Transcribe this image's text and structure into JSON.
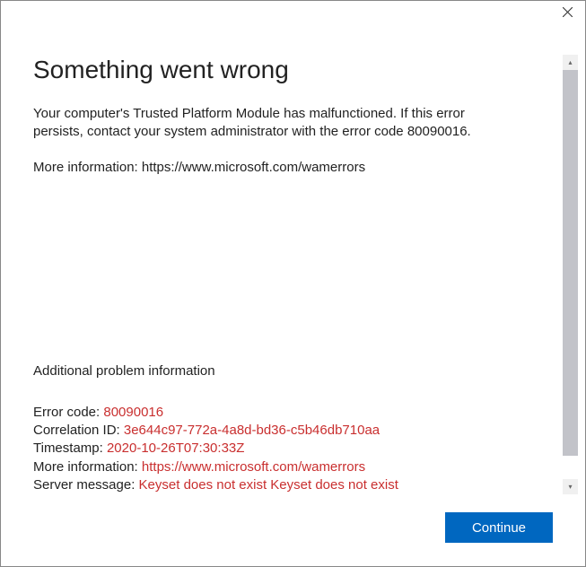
{
  "title": "Something went wrong",
  "message_line1": "Your computer's Trusted Platform Module has malfunctioned. If this error persists, contact your system administrator with the error code 80090016.",
  "message_line2": "More information: https://www.microsoft.com/wamerrors",
  "additional_heading": "Additional problem information",
  "details": {
    "error_code_label": "Error code: ",
    "error_code": "80090016",
    "correlation_label": "Correlation ID: ",
    "correlation": "3e644c97-772a-4a8d-bd36-c5b46db710aa",
    "timestamp_label": "Timestamp: ",
    "timestamp": "2020-10-26T07:30:33Z",
    "moreinfo_label": "More information: ",
    "moreinfo": "https://www.microsoft.com/wamerrors",
    "server_label": "Server message: ",
    "server": "Keyset does not exist Keyset does not exist"
  },
  "continue_label": "Continue"
}
